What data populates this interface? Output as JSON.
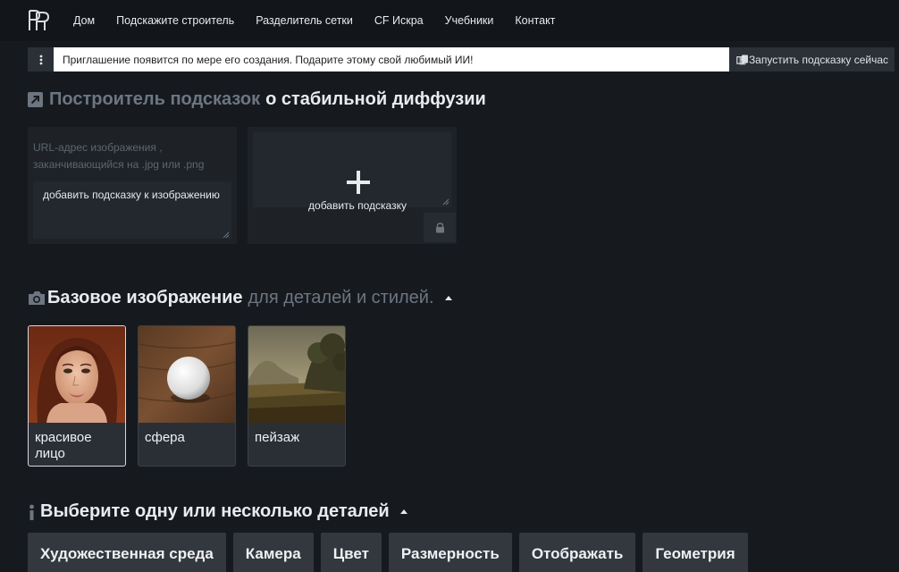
{
  "nav": {
    "logo_icon": "rp-monogram-logo",
    "links": [
      "Дом",
      "Подскажите строитель",
      "Разделитель сетки",
      "CF Искра",
      "Учебники",
      "Контакт"
    ]
  },
  "prompt_bar": {
    "menu_icon": "kebab-icon",
    "prompt_text": "Приглашение появится по мере его создания.  Подарите этому свой любимый ИИ!",
    "copy_icon": "copy-icon",
    "launch_label": "Запустить подсказку сейчас"
  },
  "builder": {
    "title_muted": "Построитель подсказок",
    "title_bright": "о стабильной диффузии",
    "url_placeholder": "URL-адрес изображения , заканчивающийся на .jpg или .png",
    "image_prompt_value": "добавить подсказку к изображению",
    "add_prompt_label": "добавить подсказку"
  },
  "base_image": {
    "title_bright": "Базовое изображение",
    "title_muted": "для деталей и стилей.",
    "cards": [
      {
        "label": "красивое лицо",
        "image": "portrait-of-woman"
      },
      {
        "label": "сфера",
        "image": "white-sphere-on-wood"
      },
      {
        "label": "пейзаж",
        "image": "landscape-painting"
      }
    ]
  },
  "details": {
    "title": "Выберите одну или несколько деталей",
    "tabs": [
      "Художественная среда",
      "Камера",
      "Цвет",
      "Размерность",
      "Отображать",
      "Геометрия"
    ]
  },
  "colors": {
    "background": "#161a1f",
    "navbar": "#121519",
    "panel": "#1e2227",
    "tab": "#33383e"
  }
}
